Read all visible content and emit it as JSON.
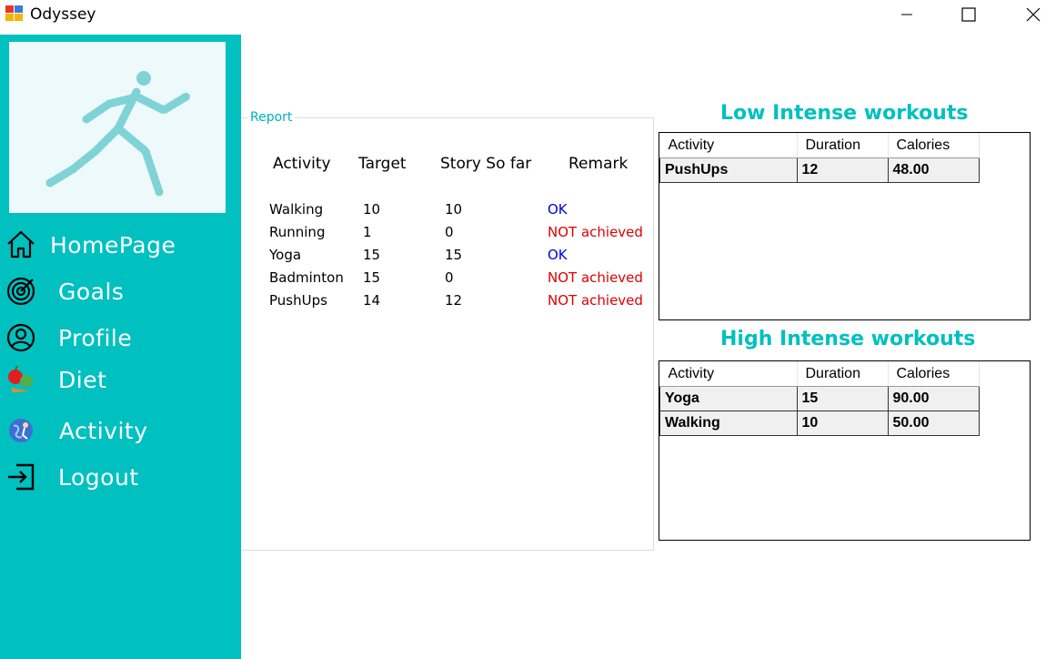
{
  "window": {
    "title": "Odyssey",
    "minimize_icon": "minimize-icon",
    "maximize_icon": "maximize-icon",
    "close_icon": "close-icon"
  },
  "colors": {
    "sidebar": "#00c0c0",
    "accent_title": "#00c0c0",
    "ok": "#0000e0",
    "not_achieved": "#e00000"
  },
  "sidebar": {
    "logo": "running-man-logo",
    "items": [
      {
        "label": "HomePage",
        "icon": "home-icon"
      },
      {
        "label": "Goals",
        "icon": "target-icon"
      },
      {
        "label": "Profile",
        "icon": "user-circle-icon"
      },
      {
        "label": "Diet",
        "icon": "fruit-veg-icon"
      },
      {
        "label": "Activity",
        "icon": "activity-globe-icon"
      },
      {
        "label": "Logout",
        "icon": "logout-icon"
      }
    ]
  },
  "report": {
    "legend": "Report",
    "headers": [
      "Activity",
      "Target",
      "Story So far",
      "Remark"
    ],
    "rows": [
      {
        "activity": "Walking",
        "target": "10",
        "so_far": "10",
        "remark": "OK",
        "status": "ok"
      },
      {
        "activity": "Running",
        "target": "1",
        "so_far": "0",
        "remark": "NOT achieved",
        "status": "bad"
      },
      {
        "activity": "Yoga",
        "target": "15",
        "so_far": "15",
        "remark": "OK",
        "status": "ok"
      },
      {
        "activity": "Badminton",
        "target": "15",
        "so_far": "0",
        "remark": "NOT achieved",
        "status": "bad"
      },
      {
        "activity": "PushUps",
        "target": "14",
        "so_far": "12",
        "remark": "NOT achieved",
        "status": "bad"
      }
    ]
  },
  "low_intense": {
    "title": "Low Intense workouts",
    "columns": [
      "Activity",
      "Duration",
      "Calories"
    ],
    "rows": [
      {
        "activity": "PushUps",
        "duration": "12",
        "calories": "48.00"
      }
    ]
  },
  "high_intense": {
    "title": "High Intense workouts",
    "columns": [
      "Activity",
      "Duration",
      "Calories"
    ],
    "rows": [
      {
        "activity": "Yoga",
        "duration": "15",
        "calories": "90.00"
      },
      {
        "activity": "Walking",
        "duration": "10",
        "calories": "50.00"
      }
    ]
  }
}
